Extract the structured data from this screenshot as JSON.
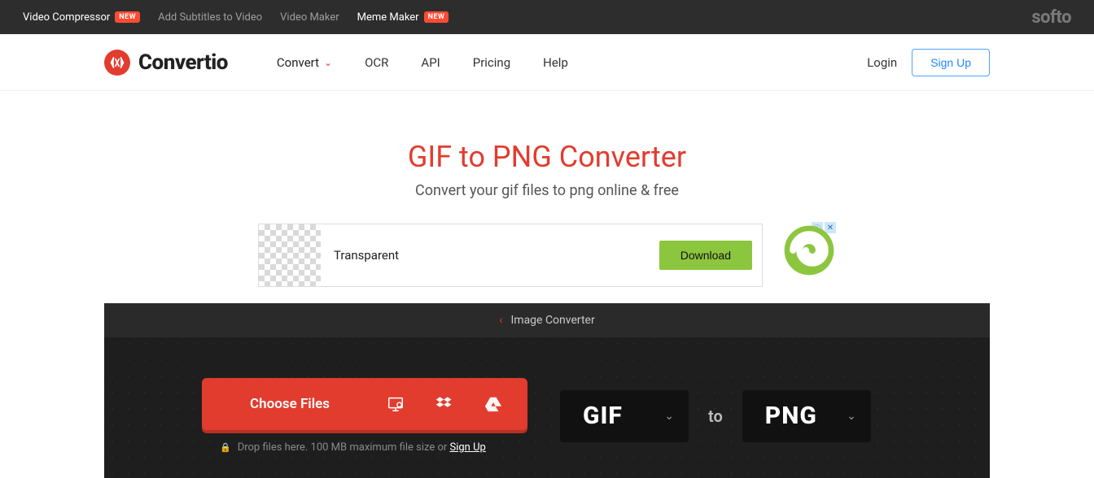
{
  "promo": {
    "links": [
      {
        "label": "Video Compressor",
        "white": true,
        "new": true
      },
      {
        "label": "Add Subtitles to Video",
        "white": false,
        "new": false
      },
      {
        "label": "Video Maker",
        "white": false,
        "new": false
      },
      {
        "label": "Meme Maker",
        "white": true,
        "new": true
      }
    ],
    "new_badge": "NEW",
    "softo": "softo"
  },
  "nav": {
    "brand": "Convertio",
    "items": [
      "Convert",
      "OCR",
      "API",
      "Pricing",
      "Help"
    ],
    "login": "Login",
    "signup": "Sign Up"
  },
  "hero": {
    "title": "GIF to PNG Converter",
    "subtitle": "Convert your gif files to png online & free"
  },
  "ad": {
    "text": "Transparent",
    "download": "Download"
  },
  "breadcrumb": {
    "label": "Image Converter"
  },
  "converter": {
    "choose_label": "Choose Files",
    "drop_hint_prefix": "Drop files here. 100 MB maximum file size or ",
    "drop_hint_link": "Sign Up",
    "from": "GIF",
    "to_word": "to",
    "to": "PNG"
  }
}
